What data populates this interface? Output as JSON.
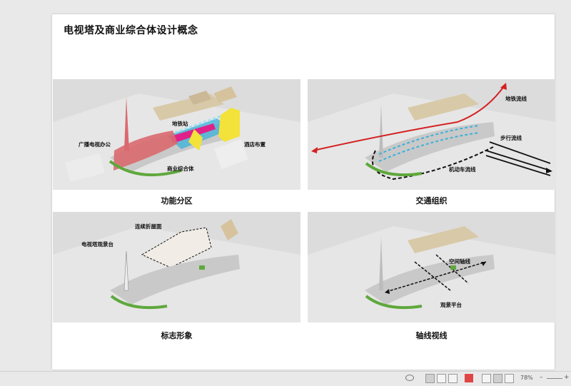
{
  "document": {
    "title": "电视塔及商业综合体设计概念"
  },
  "panels": [
    {
      "caption": "功能分区",
      "labels": [
        "广播电视办公",
        "地铁站",
        "商业综合体",
        "酒店布置"
      ]
    },
    {
      "caption": "交通组织",
      "labels": [
        "地铁流线",
        "步行流线",
        "机动车流线"
      ]
    },
    {
      "caption": "标志形象",
      "labels": [
        "连续折屋面",
        "电视塔观景台"
      ]
    },
    {
      "caption": "轴线视线",
      "labels": [
        "空间轴线",
        "观景平台"
      ]
    }
  ],
  "statusbar": {
    "zoom": "78%",
    "zoom_minus": "–",
    "zoom_plus": "+"
  },
  "colors": {
    "office": "#d9696e",
    "metro": "#e0218a",
    "commercial": "#3ab0d8",
    "hotel": "#f2e23a",
    "metro_flow": "#d42020",
    "vehicle_flow": "#111111",
    "green": "#5fa83c"
  }
}
